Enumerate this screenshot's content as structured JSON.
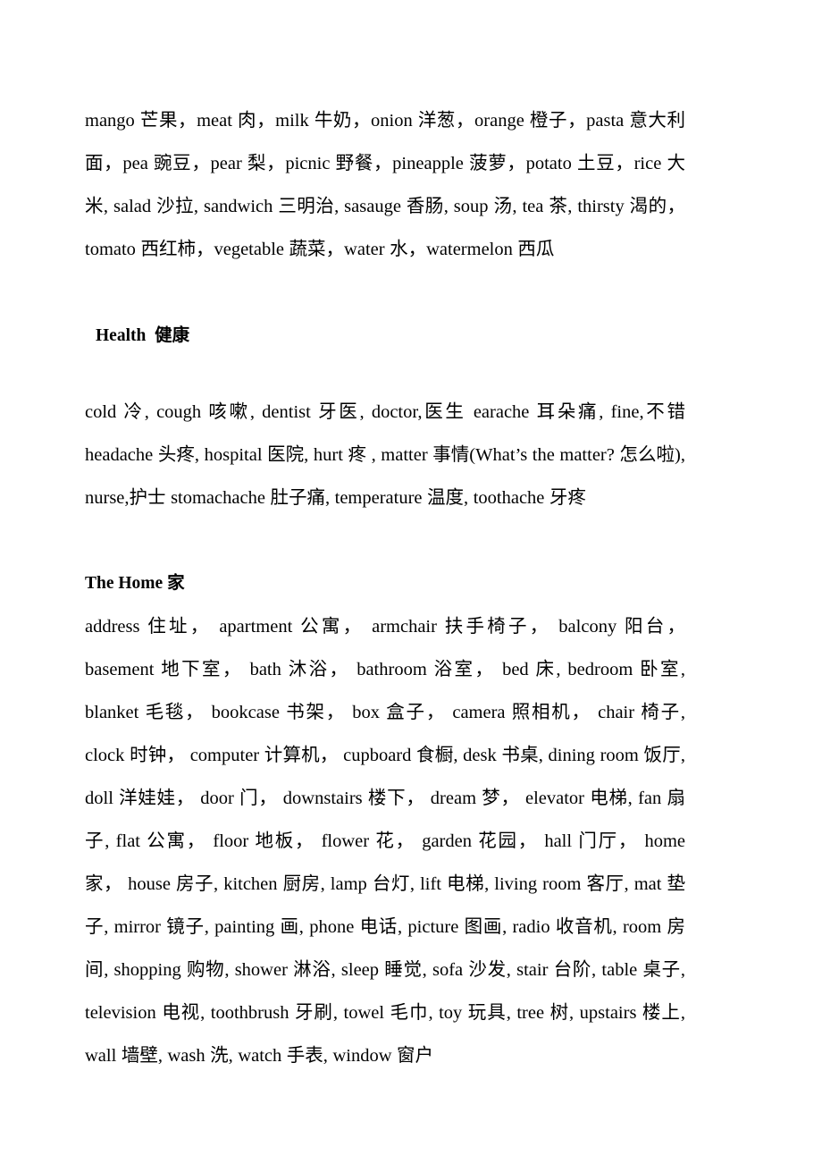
{
  "document": {
    "page_background": "#ffffff",
    "text_color": "#000000",
    "blocks": [
      {
        "kind": "paragraph",
        "name": "food-vocabulary-paragraph",
        "text": "mango 芒果，meat 肉，milk 牛奶，onion 洋葱，orange 橙子，pasta 意大利面，pea 豌豆，pear 梨，picnic 野餐，pineapple 菠萝，potato 土豆，rice 大米, salad 沙拉, sandwich 三明治, sasauge 香肠, soup 汤, tea 茶, thirsty 渴的，tomato 西红柿，vegetable 蔬菜，water 水，watermelon 西瓜"
      },
      {
        "kind": "heading",
        "name": "health-heading",
        "text": "Health  健康",
        "indented": true
      },
      {
        "kind": "paragraph",
        "name": "health-vocabulary-paragraph",
        "text": "cold 冷, cough 咳嗽, dentist 牙医, doctor,医生  earache 耳朵痛, fine,不错 headache 头疼, hospital  医院, hurt 疼 , matter  事情(What’s the matter?  怎么啦), nurse,护士  stomachache 肚子痛, temperature 温度, toothache 牙疼"
      },
      {
        "kind": "heading",
        "name": "home-heading",
        "text": "The Home 家",
        "indented": false
      },
      {
        "kind": "paragraph",
        "name": "home-vocabulary-paragraph",
        "text": "address 住址，  apartment 公寓，  armchair 扶手椅子，  balcony 阳台，basement 地下室，  bath 沐浴，  bathroom 浴室，  bed 床, bedroom 卧室, blanket 毛毯，  bookcase 书架，  box 盒子，  camera 照相机，  chair 椅子, clock 时钟，  computer 计算机，  cupboard 食橱, desk 书桌, dining room 饭厅, doll 洋娃娃，  door 门，  downstairs 楼下，  dream 梦，  elevator 电梯, fan 扇子, flat 公寓，  floor 地板，  flower 花，  garden 花园，  hall 门厅，  home 家，  house 房子, kitchen 厨房, lamp 台灯, lift 电梯, living room 客厅, mat 垫子, mirror 镜子, painting 画, phone 电话, picture 图画, radio 收音机, room 房间, shopping 购物, shower 淋浴, sleep 睡觉, sofa 沙发, stair 台阶, table 桌子, television 电视, toothbrush 牙刷, towel 毛巾, toy 玩具, tree 树, upstairs 楼上, wall 墙壁, wash 洗, watch 手表, window 窗户"
      }
    ]
  }
}
